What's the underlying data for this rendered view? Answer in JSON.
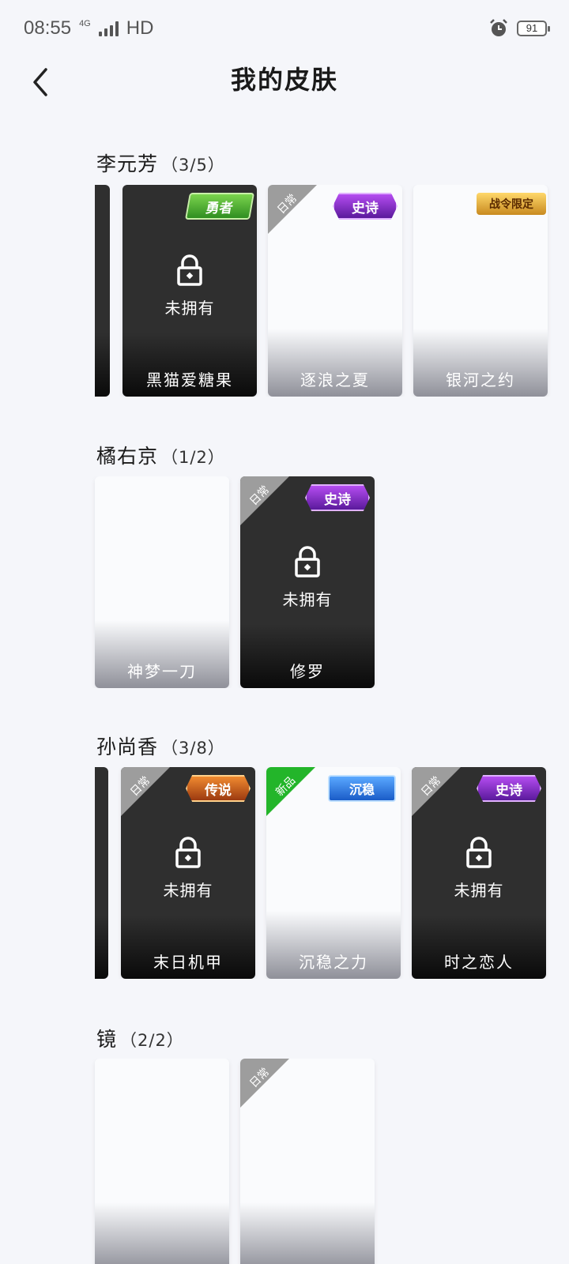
{
  "status_bar": {
    "time": "08:55",
    "network": "4G",
    "hd": "HD",
    "alarm_icon": "alarm-clock-icon",
    "battery": "91"
  },
  "header": {
    "title": "我的皮肤",
    "back_icon": "chevron-left-icon"
  },
  "unowned_label": "未拥有",
  "sections": [
    {
      "hero": "李元芳",
      "count": "（3/5）",
      "cards": [
        {
          "name": "黑猫爱糖果",
          "badge": "勇者",
          "ribbon": "",
          "locked": true
        },
        {
          "name": "逐浪之夏",
          "badge": "史诗",
          "ribbon": "日常",
          "locked": false
        },
        {
          "name": "银河之约",
          "badge": "战令限定",
          "ribbon": "",
          "locked": false
        }
      ]
    },
    {
      "hero": "橘右京",
      "count": "（1/2）",
      "cards": [
        {
          "name": "神梦一刀",
          "badge": "",
          "ribbon": "",
          "locked": false
        },
        {
          "name": "修罗",
          "badge": "史诗",
          "ribbon": "日常",
          "locked": true
        }
      ]
    },
    {
      "hero": "孙尚香",
      "count": "（3/8）",
      "cards": [
        {
          "name": "末日机甲",
          "badge": "传说",
          "ribbon": "日常",
          "locked": true
        },
        {
          "name": "沉稳之力",
          "badge": "沉稳",
          "ribbon": "新品",
          "locked": false
        },
        {
          "name": "时之恋人",
          "badge": "史诗",
          "ribbon": "日常",
          "locked": true
        }
      ]
    },
    {
      "hero": "镜",
      "count": "（2/2）",
      "cards": [
        {
          "name": "",
          "badge": "",
          "ribbon": "",
          "locked": false
        },
        {
          "name": "",
          "badge": "",
          "ribbon": "日常",
          "locked": false
        }
      ]
    }
  ]
}
